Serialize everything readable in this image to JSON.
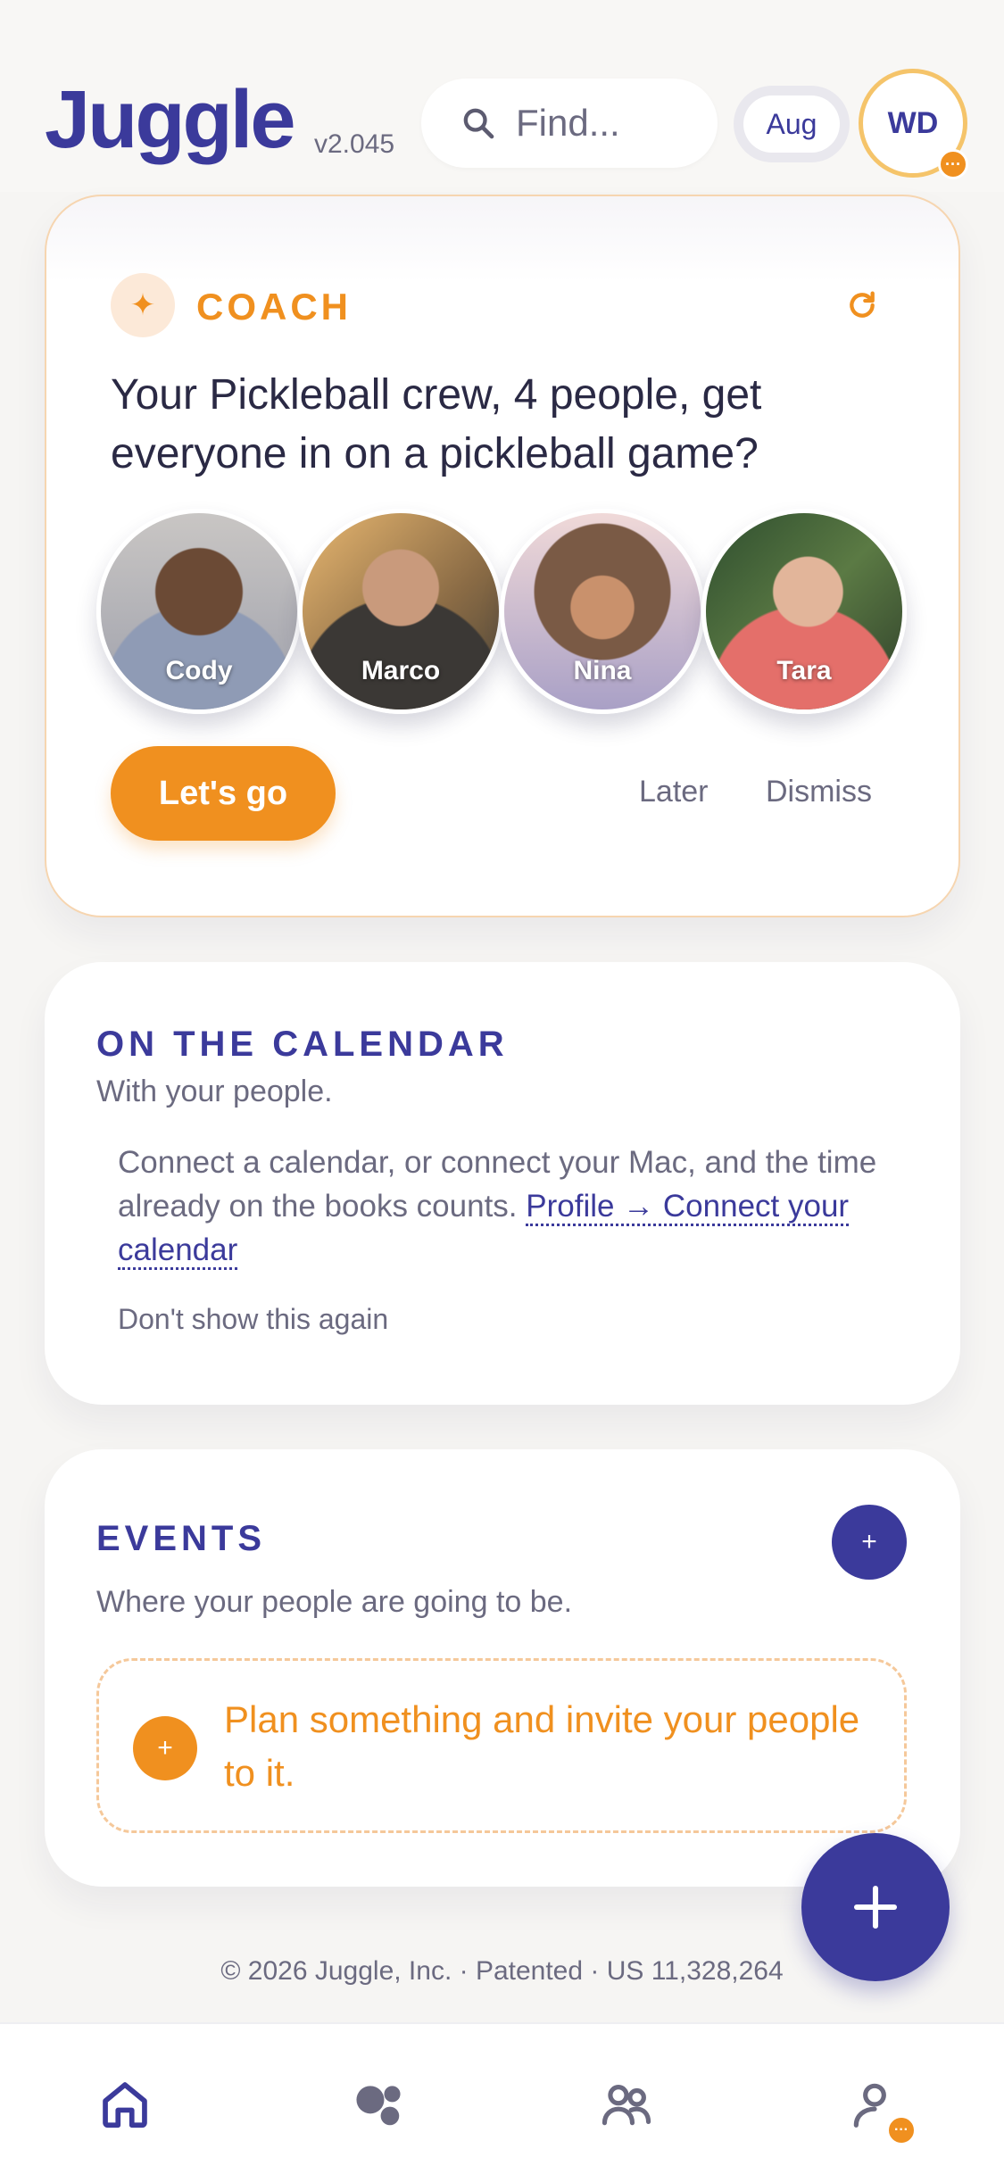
{
  "header": {
    "logo": "Juggle",
    "version": "v2.045",
    "search_placeholder": "Find...",
    "month": "Aug",
    "user_initials": "WD",
    "user_badge": "···"
  },
  "coach": {
    "label": "COACH",
    "message": "Your Pickleball crew, 4 people, get everyone in on a pickleball game?",
    "people": [
      {
        "name": "Cody"
      },
      {
        "name": "Marco"
      },
      {
        "name": "Nina"
      },
      {
        "name": "Tara"
      }
    ],
    "primary_button": "Let's go",
    "later": "Later",
    "dismiss": "Dismiss"
  },
  "calendar": {
    "title": "ON THE CALENDAR",
    "subtitle": "With your people.",
    "body": "Connect a calendar, or connect your Mac, and the time already on the books counts.",
    "link": "Profile → Connect your calendar",
    "dont_show": "Don't show this again"
  },
  "events": {
    "title": "EVENTS",
    "subtitle": "Where your people are going to be.",
    "add_label": "+",
    "plan_plus": "+",
    "plan_text": "Plan something and invite your people to it."
  },
  "footer": {
    "text": "© 2026 Juggle, Inc. · Patented · US 11,328,264"
  },
  "nav": {
    "items": [
      "home-icon",
      "bubbles-icon",
      "people-icon",
      "profile-icon"
    ],
    "profile_badge": "···"
  },
  "colors": {
    "brand": "#3b3a9b",
    "accent": "#f0901f",
    "muted_text": "#6b6a80",
    "background": "#f6f5f3"
  }
}
